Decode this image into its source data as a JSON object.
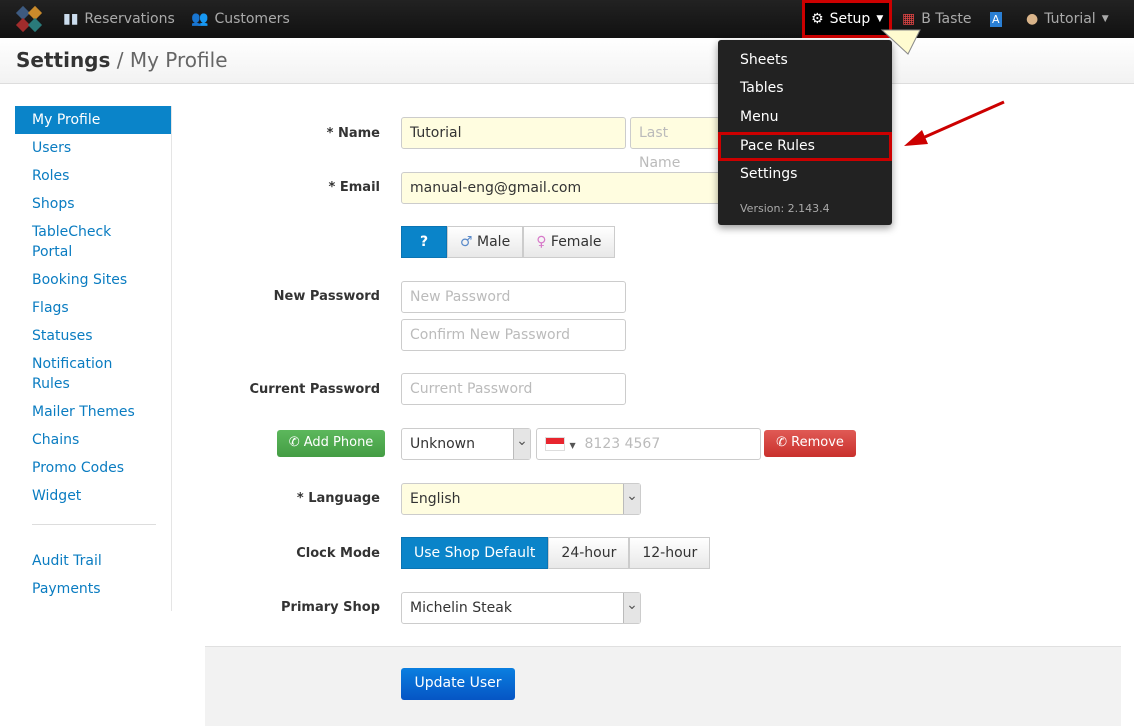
{
  "topnav": {
    "reservations": "Reservations",
    "customers": "Customers",
    "setup": "Setup",
    "shop": "B Taste",
    "user": "Tutorial"
  },
  "header": {
    "section": "Settings",
    "sep": " / ",
    "page": "My Profile"
  },
  "sidebar": {
    "items": [
      "My Profile",
      "Users",
      "Roles",
      "Shops",
      "TableCheck Portal",
      "Booking Sites",
      "Flags",
      "Statuses",
      "Notification Rules",
      "Mailer Themes",
      "Chains",
      "Promo Codes",
      "Widget"
    ],
    "bottom": [
      "Audit Trail",
      "Payments"
    ]
  },
  "setup_menu": {
    "items": [
      "Sheets",
      "Tables",
      "Menu",
      "Pace Rules",
      "Settings"
    ],
    "version": "Version: 2.143.4"
  },
  "form": {
    "name_label": "Name",
    "first_name": "Tutorial",
    "last_name_placeholder": "Last Name",
    "email_label": "Email",
    "email": "manual-eng@gmail.com",
    "gender": {
      "unknown": "?",
      "male": "Male",
      "female": "Female"
    },
    "new_password_label": "New Password",
    "new_password_placeholder": "New Password",
    "confirm_placeholder": "Confirm New Password",
    "current_password_label": "Current Password",
    "current_password_placeholder": "Current Password",
    "add_phone": "Add Phone",
    "phone_type": "Unknown",
    "phone_placeholder": "8123 4567",
    "remove": "Remove",
    "language_label": "Language",
    "language": "English",
    "clock_label": "Clock Mode",
    "clock_options": [
      "Use Shop Default",
      "24-hour",
      "12-hour"
    ],
    "primary_shop_label": "Primary Shop",
    "primary_shop": "Michelin Steak",
    "required_mark": "*",
    "update": "Update User"
  }
}
